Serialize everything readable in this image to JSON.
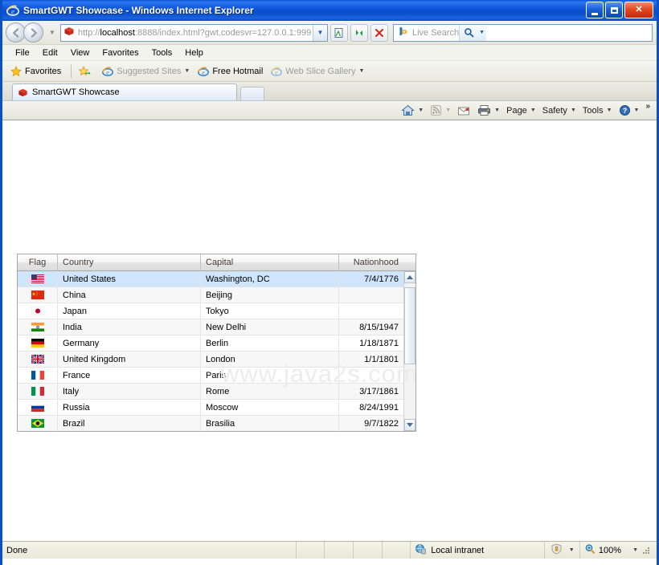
{
  "window": {
    "title": "SmartGWT Showcase - Windows Internet Explorer",
    "app_icon": "ie-logo-icon",
    "minimize_label": "Minimize",
    "maximize_label": "Maximize",
    "close_label": "Close"
  },
  "navbar": {
    "back_label": "Back",
    "forward_label": "Forward",
    "history_label": "Recent Pages",
    "address": {
      "favicon": "smartgwt-icon",
      "url_prefix": "http://",
      "url_host": "localhost",
      "url_rest": ":8888/index.html?gwt.codesvr=127.0.0.1:999",
      "full_url": "http://localhost:8888/index.html?gwt.codesvr=127.0.0.1:999",
      "dropdown_label": "Address dropdown"
    },
    "compat_label": "Compatibility View",
    "refresh_label": "Refresh",
    "stop_label": "Stop",
    "search": {
      "placeholder": "Live Search",
      "provider_icon": "bing-icon",
      "go_label": "Search",
      "dropdown_label": "Search options"
    }
  },
  "menubar": {
    "items": [
      {
        "label": "File"
      },
      {
        "label": "Edit"
      },
      {
        "label": "View"
      },
      {
        "label": "Favorites"
      },
      {
        "label": "Tools"
      },
      {
        "label": "Help"
      }
    ]
  },
  "favorites_bar": {
    "favorites_label": "Favorites",
    "items": [
      {
        "label": "Suggested Sites",
        "icon": "ie-small-icon",
        "has_caret": true,
        "dim": true
      },
      {
        "label": "Free Hotmail",
        "icon": "ie-small-icon",
        "has_caret": false,
        "dim": false
      },
      {
        "label": "Web Slice Gallery",
        "icon": "ie-small-icon",
        "has_caret": true,
        "dim": true
      }
    ]
  },
  "tabbar": {
    "tabs": [
      {
        "label": "SmartGWT Showcase",
        "icon": "smartgwt-icon",
        "active": true
      }
    ],
    "new_tab_label": "New Tab"
  },
  "command_bar": {
    "items": [
      {
        "label": "",
        "icon": "home-icon",
        "has_caret": true
      },
      {
        "label": "",
        "icon": "rss-icon",
        "has_caret": true
      },
      {
        "label": "",
        "icon": "mail-icon",
        "has_caret": false
      },
      {
        "label": "",
        "icon": "print-icon",
        "has_caret": true
      },
      {
        "label": "Page",
        "icon": "",
        "has_caret": true
      },
      {
        "label": "Safety",
        "icon": "",
        "has_caret": true
      },
      {
        "label": "Tools",
        "icon": "",
        "has_caret": true
      },
      {
        "label": "",
        "icon": "help-icon",
        "has_caret": true
      }
    ],
    "overflow_label": "»"
  },
  "page": {
    "watermark": "www.java2s.com",
    "grid": {
      "columns": [
        {
          "key": "flag",
          "label": "Flag",
          "align": "center"
        },
        {
          "key": "country",
          "label": "Country",
          "align": "left"
        },
        {
          "key": "capital",
          "label": "Capital",
          "align": "left"
        },
        {
          "key": "nationhood",
          "label": "Nationhood",
          "align": "right"
        }
      ],
      "rows": [
        {
          "flag": "us-flag-icon",
          "country": "United States",
          "capital": "Washington, DC",
          "nationhood": "7/4/1776",
          "selected": true
        },
        {
          "flag": "cn-flag-icon",
          "country": "China",
          "capital": "Beijing",
          "nationhood": "",
          "selected": false
        },
        {
          "flag": "jp-flag-icon",
          "country": "Japan",
          "capital": "Tokyo",
          "nationhood": "",
          "selected": false
        },
        {
          "flag": "in-flag-icon",
          "country": "India",
          "capital": "New Delhi",
          "nationhood": "8/15/1947",
          "selected": false
        },
        {
          "flag": "de-flag-icon",
          "country": "Germany",
          "capital": "Berlin",
          "nationhood": "1/18/1871",
          "selected": false
        },
        {
          "flag": "gb-flag-icon",
          "country": "United Kingdom",
          "capital": "London",
          "nationhood": "1/1/1801",
          "selected": false
        },
        {
          "flag": "fr-flag-icon",
          "country": "France",
          "capital": "Paris",
          "nationhood": "",
          "selected": false
        },
        {
          "flag": "it-flag-icon",
          "country": "Italy",
          "capital": "Rome",
          "nationhood": "3/17/1861",
          "selected": false
        },
        {
          "flag": "ru-flag-icon",
          "country": "Russia",
          "capital": "Moscow",
          "nationhood": "8/24/1991",
          "selected": false
        },
        {
          "flag": "br-flag-icon",
          "country": "Brazil",
          "capital": "Brasilia",
          "nationhood": "9/7/1822",
          "selected": false
        }
      ],
      "scrollbar": {
        "up_label": "Scroll up",
        "down_label": "Scroll down"
      }
    }
  },
  "statusbar": {
    "status": "Done",
    "zone": "Local intranet",
    "zone_icon": "globe-icon",
    "protected_icon": "protected-mode-icon",
    "zoom": "100%",
    "zoom_icon": "zoom-icon"
  },
  "colors": {
    "titlebar_blue": "#0a51c8",
    "selection_blue": "#cfe5fb",
    "header_text": "#4a3b32",
    "chrome_beige": "#e9e8d8",
    "watermark_gray": "#ececed"
  }
}
